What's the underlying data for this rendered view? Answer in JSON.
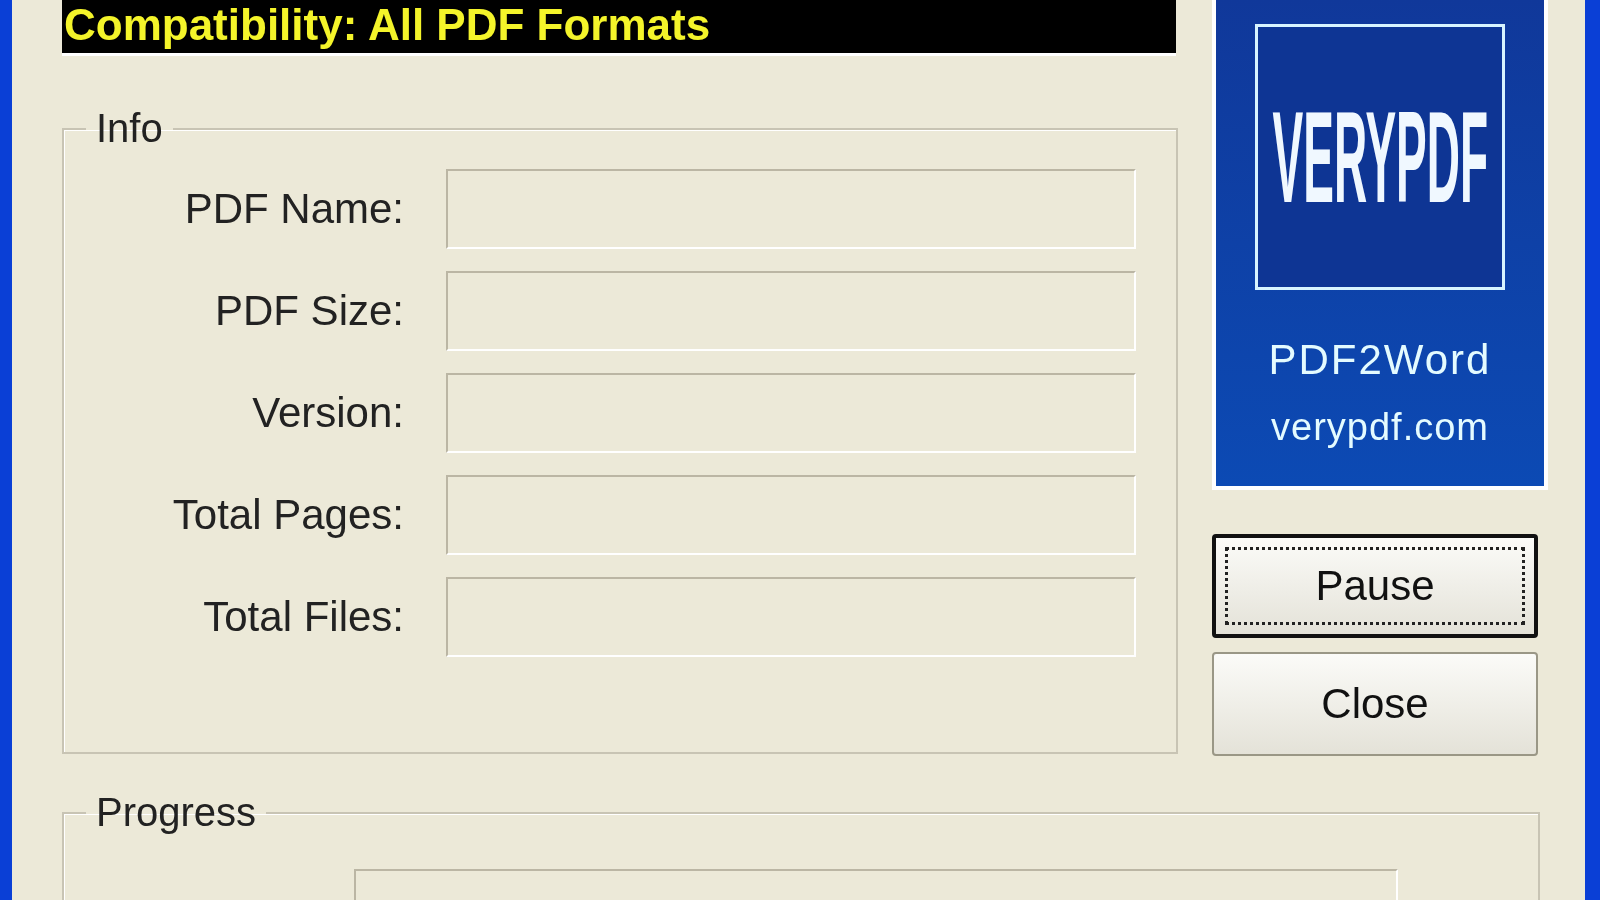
{
  "banner": {
    "text": "Compatibility: All PDF Formats"
  },
  "info": {
    "title": "Info",
    "fields": [
      {
        "label": "PDF Name:"
      },
      {
        "label": "PDF Size:"
      },
      {
        "label": "Version:"
      },
      {
        "label": "Total Pages:"
      },
      {
        "label": "Total Files:"
      }
    ]
  },
  "logo": {
    "brand": "VERYPDF",
    "product": "PDF2Word",
    "site": "verypdf.com"
  },
  "buttons": [
    {
      "label": "Pause",
      "default": true
    },
    {
      "label": "Close",
      "default": false
    }
  ],
  "progress": {
    "title": "Progress",
    "level": 0
  }
}
